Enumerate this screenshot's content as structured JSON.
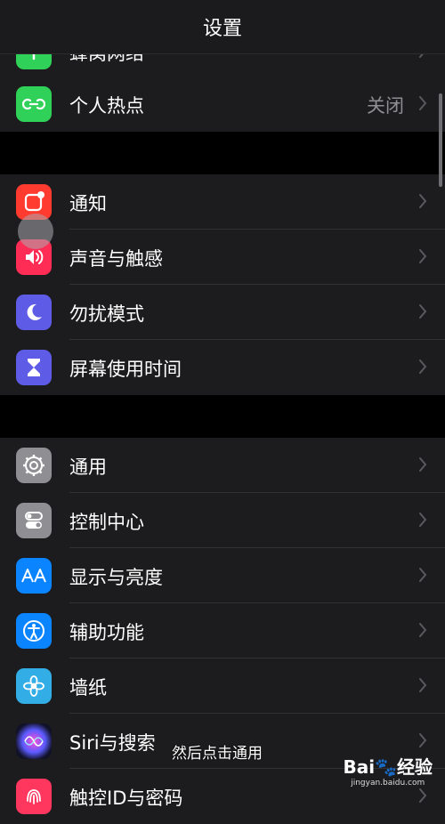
{
  "nav": {
    "title": "设置"
  },
  "groups": [
    {
      "rows": [
        {
          "label": "蜂窝网络",
          "value": "",
          "icon": "cellular-icon",
          "color": "#30d158"
        },
        {
          "label": "个人热点",
          "value": "关闭",
          "icon": "hotspot-icon",
          "color": "#30d158"
        }
      ]
    },
    {
      "rows": [
        {
          "label": "通知",
          "value": "",
          "icon": "notifications-icon",
          "color": "#ff3b30"
        },
        {
          "label": "声音与触感",
          "value": "",
          "icon": "speaker-icon",
          "color": "#ff2d55"
        },
        {
          "label": "勿扰模式",
          "value": "",
          "icon": "moon-icon",
          "color": "#5e5ce6"
        },
        {
          "label": "屏幕使用时间",
          "value": "",
          "icon": "hourglass-icon",
          "color": "#5e5ce6"
        }
      ]
    },
    {
      "rows": [
        {
          "label": "通用",
          "value": "",
          "icon": "gear-icon",
          "color": "#8e8e93"
        },
        {
          "label": "控制中心",
          "value": "",
          "icon": "toggles-icon",
          "color": "#8e8e93"
        },
        {
          "label": "显示与亮度",
          "value": "",
          "icon": "display-aa-icon",
          "color": "#0a84ff"
        },
        {
          "label": "辅助功能",
          "value": "",
          "icon": "accessibility-icon",
          "color": "#0a84ff"
        },
        {
          "label": "墙纸",
          "value": "",
          "icon": "flower-icon",
          "color": "#32ade6"
        },
        {
          "label": "Siri与搜索",
          "value": "",
          "icon": "siri-icon",
          "color": "#1c1c3a"
        },
        {
          "label": "触控ID与密码",
          "value": "",
          "icon": "fingerprint-icon",
          "color": "#ff375f"
        }
      ]
    }
  ],
  "overlay": {
    "caption": "然后点击通用"
  },
  "watermark": {
    "brand": "Bai🐾经验",
    "url": "jingyan.baidu.com"
  }
}
